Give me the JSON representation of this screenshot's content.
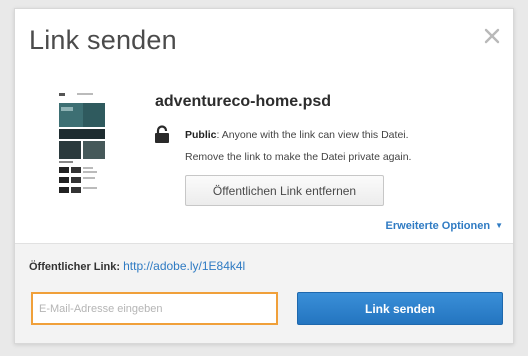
{
  "dialog": {
    "title": "Link senden",
    "close_icon": "close-icon"
  },
  "file": {
    "name": "adventureco-home.psd",
    "thumbnail_icon": "file-thumbnail-icon"
  },
  "permission": {
    "lock_icon": "lock-icon",
    "label": "Public",
    "description": ": Anyone with the link can view this Datei.",
    "line2": "Remove the link to make the Datei private again."
  },
  "actions": {
    "remove_link_label": "Öffentlichen Link entfernen",
    "advanced_label": "Erweiterte Optionen",
    "advanced_caret_icon": "caret-down-icon"
  },
  "footer": {
    "public_link_label": "Öffentlicher Link:",
    "public_link_url": "http://adobe.ly/1E84k4l",
    "email_placeholder": "E-Mail-Adresse eingeben",
    "email_value": "",
    "send_label": "Link senden"
  },
  "colors": {
    "accent": "#2f7bc3",
    "input_focus": "#f0a03a",
    "send_button": "#2a7fc8"
  }
}
